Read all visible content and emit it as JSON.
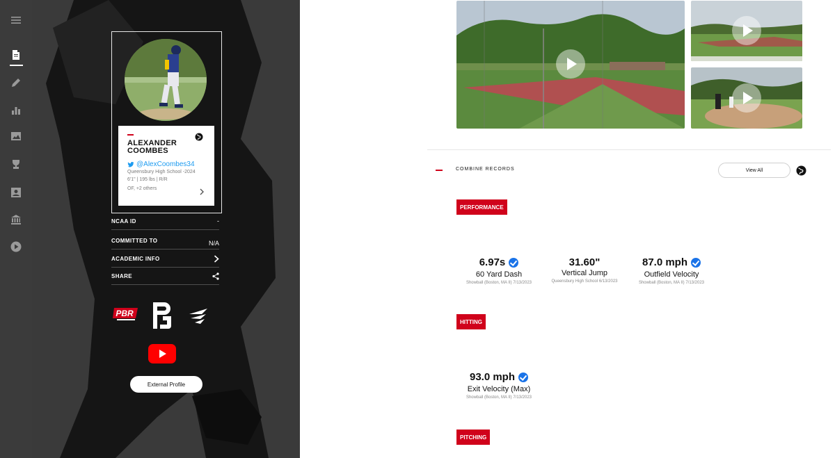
{
  "rail": {
    "items": [
      {
        "icon": "menu-icon"
      },
      {
        "icon": "document-icon",
        "active": true
      },
      {
        "icon": "pencil-icon"
      },
      {
        "icon": "bar-chart-icon"
      },
      {
        "icon": "image-icon"
      },
      {
        "icon": "trophy-icon"
      },
      {
        "icon": "portrait-icon"
      },
      {
        "icon": "bank-icon"
      },
      {
        "icon": "play-circle-icon"
      }
    ]
  },
  "profile": {
    "name_line1": "ALEXANDER",
    "name_line2": "COOMBES",
    "twitter": "@AlexCoombes34",
    "school": "Queensbury High School -2024",
    "measurements": "6'1\" | 195 lbs | R/R",
    "positions": "OF, +2 others"
  },
  "meta": [
    {
      "label": "NCAA ID",
      "value": "-"
    },
    {
      "label": "COMMITTED TO",
      "value": "N/A"
    },
    {
      "label": "ACADEMIC INFO",
      "value": ""
    },
    {
      "label": "SHARE",
      "value": ""
    }
  ],
  "brands": {
    "pbr_text": "PBR",
    "pg_text": "PG"
  },
  "external_profile_label": "External Profile",
  "combine": {
    "section_title": "COMBINE RECORDS",
    "view_all_label": "View All",
    "categories": [
      {
        "name": "PERFORMANCE",
        "stats": [
          {
            "value": "6.97s",
            "label": "60 Yard Dash",
            "source": "Showball (Boston, MA II) 7/13/2023",
            "verified": true
          },
          {
            "value": "31.60\"",
            "label": "Vertical Jump",
            "source": "Queensbury High School 6/13/2023",
            "verified": false
          },
          {
            "value": "87.0 mph",
            "label": "Outfield Velocity",
            "source": "Showball (Boston, MA II) 7/13/2023",
            "verified": true
          }
        ]
      },
      {
        "name": "HITTING",
        "stats": [
          {
            "value": "93.0 mph",
            "label": "Exit Velocity (Max)",
            "source": "Showball (Boston, MA II) 7/13/2023",
            "verified": true
          }
        ]
      },
      {
        "name": "PITCHING",
        "stats": []
      }
    ]
  }
}
